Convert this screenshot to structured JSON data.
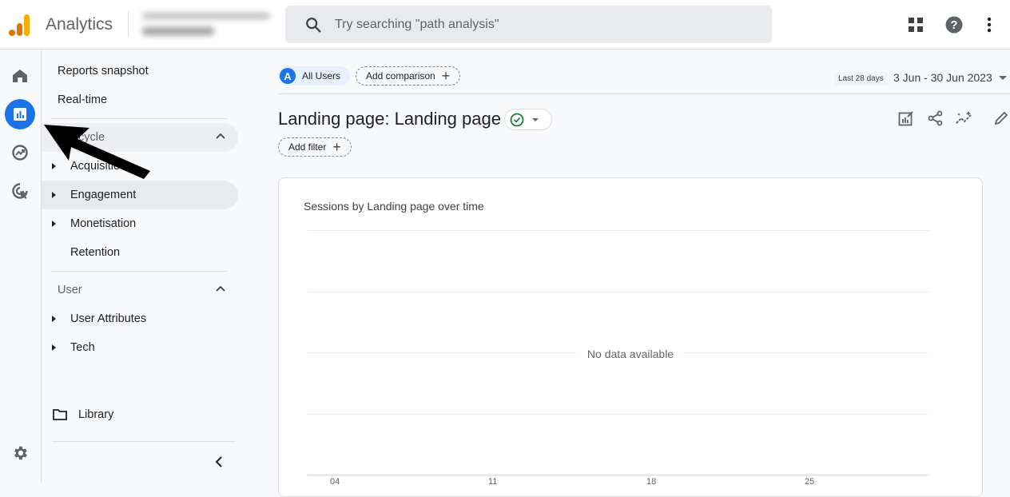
{
  "header": {
    "app_title": "Analytics",
    "account_selector": "(blurred account)",
    "search": {
      "placeholder": "Try searching \"path analysis\"",
      "value": ""
    },
    "icons": [
      "apps-grid-icon",
      "help-icon",
      "more-vert-icon"
    ]
  },
  "rail": {
    "items": [
      {
        "name": "home",
        "icon": "home-icon",
        "active": false
      },
      {
        "name": "reports",
        "icon": "bar-chart-icon",
        "active": true
      },
      {
        "name": "explore",
        "icon": "explore-trend-icon",
        "active": false
      },
      {
        "name": "advertising",
        "icon": "cursor-target-icon",
        "active": false
      }
    ],
    "settings_icon": "gear-icon"
  },
  "nav": {
    "top_items": [
      "Reports snapshot",
      "Real-time"
    ],
    "sections": [
      {
        "label": "Life cycle",
        "visible_label": "cycle",
        "expanded": true,
        "items": [
          {
            "label": "Acquisition",
            "visible_label": "Acquisitio",
            "expandable": true,
            "selected": false
          },
          {
            "label": "Engagement",
            "expandable": true,
            "selected": true
          },
          {
            "label": "Monetisation",
            "expandable": true,
            "selected": false
          },
          {
            "label": "Retention",
            "expandable": false,
            "selected": false
          }
        ]
      },
      {
        "label": "User",
        "expanded": true,
        "items": [
          {
            "label": "User Attributes",
            "expandable": true,
            "selected": false
          },
          {
            "label": "Tech",
            "expandable": true,
            "selected": false
          }
        ]
      }
    ],
    "library_label": "Library"
  },
  "main": {
    "comparison": {
      "segment_avatar": "A",
      "segment_label": "All Users",
      "add_comparison_label": "Add comparison"
    },
    "date": {
      "preset_label": "Last 28 days",
      "range_label": "3 Jun - 30 Jun 2023"
    },
    "page_title": "Landing page: Landing page",
    "add_filter_label": "Add filter",
    "actions": [
      "customize-report-icon",
      "share-icon",
      "insights-icon",
      "edit-icon"
    ],
    "accent_color": "#1a73e8",
    "status_color": "#188038"
  },
  "chart_data": {
    "type": "line",
    "title": "Sessions by Landing page over time",
    "annotation": "No data available",
    "x": [
      "04",
      "11",
      "18",
      "25"
    ],
    "xlabel": "",
    "ylabel": "",
    "series": [],
    "grid": true,
    "legend": "none"
  }
}
